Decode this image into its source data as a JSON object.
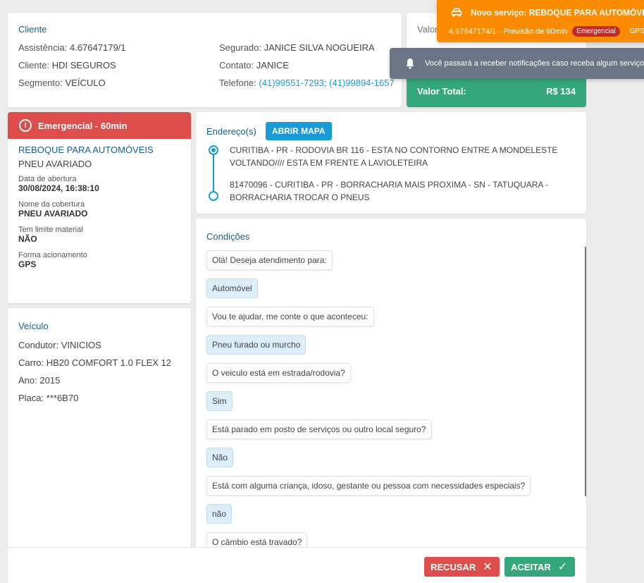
{
  "cliente": {
    "title": "Cliente",
    "assistencia_label": "Assistência:",
    "assistencia": "4.67647179/1",
    "cliente_label": "Cliente:",
    "cliente": "HDI SEGUROS",
    "segmento_label": "Segmento:",
    "segmento": "VEÍCULO",
    "segurado_label": "Segurado:",
    "segurado": "JANICE SILVA NOGUEIRA",
    "contato_label": "Contato:",
    "contato": "JANICE",
    "telefone_label": "Telefone:",
    "telefone": "(41)99551-7293; (41)99894-1657"
  },
  "valor": {
    "label": "Valor",
    "total_label": "Valor Total:",
    "total": "R$ 134"
  },
  "service": {
    "header": "Emergencial - 60min",
    "name": "REBOQUE PARA AUTOMÓVEIS",
    "sub": "PNEU AVARIADO",
    "fields": [
      {
        "label": "Data de abertura",
        "value": "30/08/2024, 16:38:10"
      },
      {
        "label": "Nome da cobertura",
        "value": "PNEU AVARIADO"
      },
      {
        "label": "Tem limite material",
        "value": "NÃO"
      },
      {
        "label": "Forma acionamento",
        "value": "GPS"
      }
    ]
  },
  "veiculo": {
    "title": "Veículo",
    "rows": [
      {
        "label": "Condutor:",
        "value": "VINICIOS"
      },
      {
        "label": "Carro:",
        "value": "HB20 COMFORT 1.0 FLEX 12"
      },
      {
        "label": "Ano:",
        "value": "2015"
      },
      {
        "label": "Placa:",
        "value": "***6B70"
      }
    ]
  },
  "endereco": {
    "title": "Endereço(s)",
    "map_button": "ABRIR MAPA",
    "origem": "CURITIBA - PR - RODOVIA BR 116 - ESTA NO CONTORNO ENTRE A MONDELESTE VOLTANDO//// ESTA EM FRENTE A LAVIOLETEIRA",
    "destino": "81470096 - CURITIBA - PR - BORRACHARIA MAIS PROXIMA - SN - TATUQUARA - BORRACHARIA TROCAR O PNEUS"
  },
  "condicoes": {
    "title": "Condições",
    "messages": [
      {
        "type": "q",
        "text": "Olá! Deseja atendimento para:"
      },
      {
        "type": "a",
        "text": "Automóvel"
      },
      {
        "type": "q",
        "text": "Vou te ajudar, me conte o que aconteceu:"
      },
      {
        "type": "a",
        "text": "Pneu furado ou murcho"
      },
      {
        "type": "q",
        "text": "O veiculo está em estrada/rodovia?"
      },
      {
        "type": "a",
        "text": "Sim"
      },
      {
        "type": "q",
        "text": "Está parado em posto de serviços ou outro local seguro?"
      },
      {
        "type": "a",
        "text": "Não"
      },
      {
        "type": "q",
        "text": "Está com alguma criança, idoso, gestante ou pessoa com necessidades especiais?"
      },
      {
        "type": "a",
        "text": "não"
      },
      {
        "type": "q",
        "text": "O câmbio está travado?"
      },
      {
        "type": "a",
        "text": ""
      }
    ]
  },
  "actions": {
    "recusar": "RECUSAR",
    "aceitar": "ACEITAR"
  },
  "toast_new": {
    "title": "Novo serviço: REBOQUE PARA AUTOMÓVEIS",
    "detail": "4.67647174/1 - Previsão de 60min",
    "badge": "Emergencial",
    "gps": "GPS"
  },
  "toast_notif": {
    "text": "Você passará a receber notificações caso receba algum serviço"
  },
  "colors": {
    "primary": "#1b9bd6",
    "danger": "#dd4d4b",
    "success": "#34a87c",
    "warning": "#fb8c00",
    "title": "#1d5c8a"
  }
}
